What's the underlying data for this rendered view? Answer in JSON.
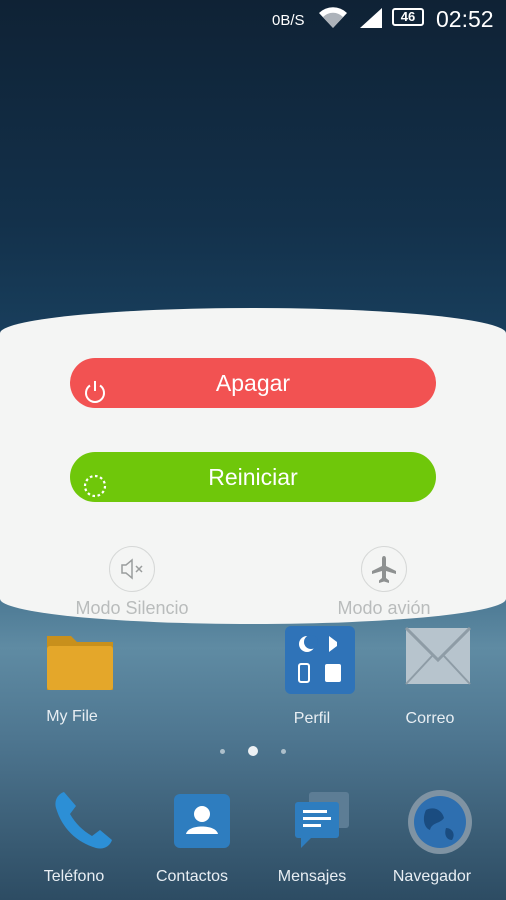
{
  "status_bar": {
    "net_speed": "0B/S",
    "battery": "46",
    "time": "02:52"
  },
  "power_menu": {
    "power_off_label": "Apagar",
    "restart_label": "Reiniciar",
    "silent_mode_label": "Modo Silencio",
    "airplane_mode_label": "Modo avión",
    "colors": {
      "power_off": "#f25252",
      "restart": "#6fc70a"
    }
  },
  "home": {
    "row_apps": [
      {
        "label": "My File",
        "icon": "folder-icon"
      },
      {
        "label": "Perfil",
        "icon": "profile-icon"
      },
      {
        "label": "Correo",
        "icon": "mail-icon"
      }
    ],
    "dock": [
      {
        "label": "Teléfono",
        "icon": "phone-icon"
      },
      {
        "label": "Contactos",
        "icon": "contacts-icon"
      },
      {
        "label": "Mensajes",
        "icon": "messages-icon"
      },
      {
        "label": "Navegador",
        "icon": "globe-icon"
      }
    ],
    "page_indicator": {
      "pages": 3,
      "current": 2
    }
  }
}
